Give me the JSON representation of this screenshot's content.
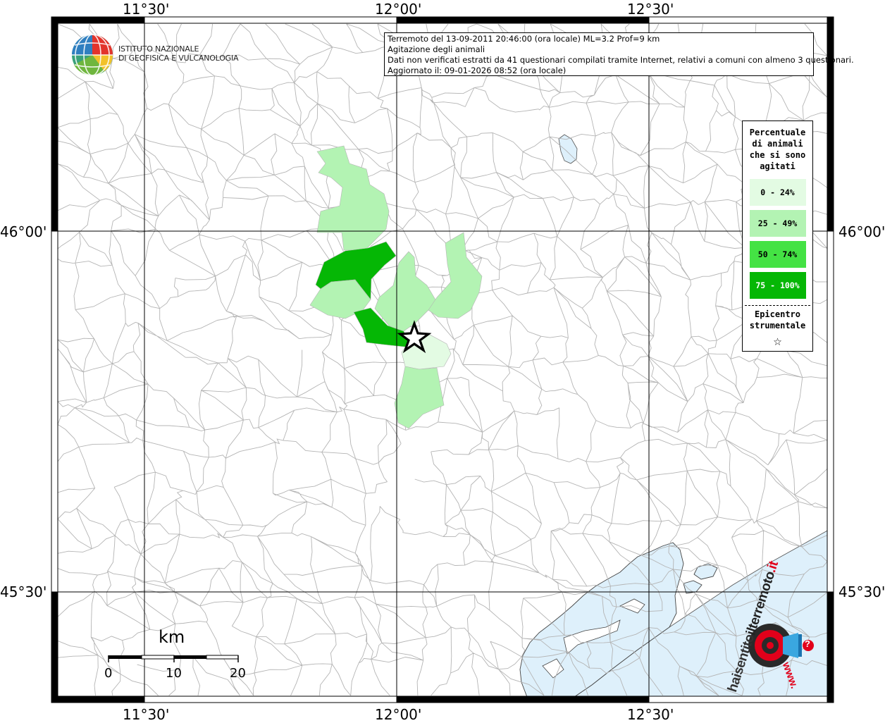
{
  "info": {
    "line1": "Terremoto del 13-09-2011 20:46:00 (ora locale) ML=3.2 Prof=9 km",
    "line2": "Agitazione degli animali",
    "line3": "Dati non verificati estratti da 41 questionari compilati tramite Internet, relativi a comuni con almeno 3 questionari.",
    "line4": "Aggiornato il: 09-01-2026 08:52 (ora locale)"
  },
  "logo": {
    "line1": "ISTITUTO NAZIONALE",
    "line2": "DI GEOFISICA E VULCANOLOGIA",
    "icon": "ingv-globe-icon"
  },
  "axes": {
    "lon_labels": [
      "11°30'",
      "12°00'",
      "12°30'"
    ],
    "lat_labels": [
      "46°00'",
      "45°30'"
    ]
  },
  "legend": {
    "title_lines": [
      "Percentuale",
      "di animali",
      "che si sono",
      "agitati"
    ],
    "classes": [
      {
        "label": "0 - 24%",
        "color": "#e3fbe3"
      },
      {
        "label": "25 - 49%",
        "color": "#b3f3b3"
      },
      {
        "label": "50 - 74%",
        "color": "#44e244"
      },
      {
        "label": "75 - 100%",
        "color": "#05b705"
      }
    ],
    "epicenter_lines": [
      "Epicentro",
      "strumentale"
    ],
    "epicenter_symbol": "☆"
  },
  "scale": {
    "unit": "km",
    "labels": [
      "0",
      "10",
      "20"
    ]
  },
  "watermark": {
    "text_left": "haisentito",
    "text_mid": "ilterremoto",
    "text_right": ".it",
    "bottom": "www.",
    "icon": "megaphone-icon",
    "badge": "?"
  },
  "colors": {
    "sea": "#def0fb",
    "border": "#b4b4b4",
    "grid": "#000000"
  }
}
